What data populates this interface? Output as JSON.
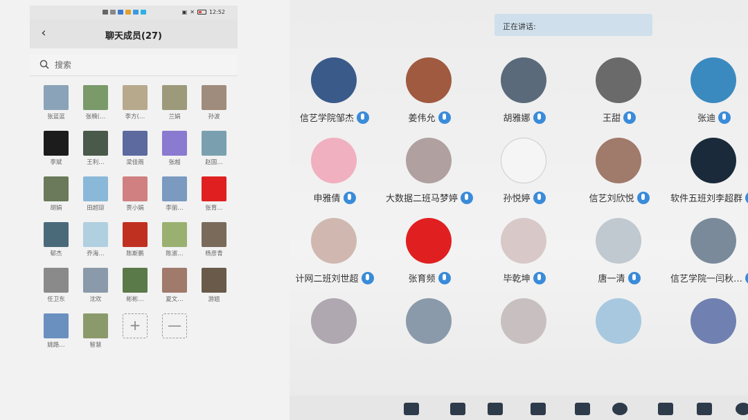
{
  "phone": {
    "status": {
      "time": "12:52"
    },
    "header": {
      "title": "聊天成员(27)"
    },
    "search": {
      "placeholder": "搜索"
    },
    "members": [
      {
        "name": "张蓝蓝",
        "color": "#8aa3b8"
      },
      {
        "name": "张楠(…",
        "color": "#7a9a6a"
      },
      {
        "name": "李方(…",
        "color": "#b7a98c"
      },
      {
        "name": "兰娟",
        "color": "#9c9a7a"
      },
      {
        "name": "孙波",
        "color": "#a08c7c"
      },
      {
        "name": "李斌",
        "color": "#1c1c1c"
      },
      {
        "name": "王利…",
        "color": "#4a5a4a"
      },
      {
        "name": "梁佳雨",
        "color": "#5c6aa0"
      },
      {
        "name": "张越",
        "color": "#8a7ad0"
      },
      {
        "name": "赵国…",
        "color": "#7aa0b0"
      },
      {
        "name": "胡娟",
        "color": "#6a7a5a"
      },
      {
        "name": "田超琼",
        "color": "#8ab8d8"
      },
      {
        "name": "贾小娟",
        "color": "#d08080"
      },
      {
        "name": "李丽…",
        "color": "#7a9ac0"
      },
      {
        "name": "张育…",
        "color": "#e02020"
      },
      {
        "name": "郁杰",
        "color": "#4a6a7a"
      },
      {
        "name": "乔海…",
        "color": "#b0d0e0"
      },
      {
        "name": "陈斯鹏",
        "color": "#c03020"
      },
      {
        "name": "陈淑…",
        "color": "#9ab070"
      },
      {
        "name": "杨彦青",
        "color": "#7a6a5a"
      },
      {
        "name": "任卫东",
        "color": "#8a8a8a"
      },
      {
        "name": "沈欢",
        "color": "#8a9aaa"
      },
      {
        "name": "彬彬…",
        "color": "#5a7a4a"
      },
      {
        "name": "夏文…",
        "color": "#a07a6a"
      },
      {
        "name": "游姐",
        "color": "#6a5a4a"
      },
      {
        "name": "姚路…",
        "color": "#6a90c0"
      },
      {
        "name": "智慧",
        "color": "#8a9a6a"
      }
    ],
    "add_label": "+",
    "remove_label": "—"
  },
  "meeting": {
    "speaking_label": "正在讲话:",
    "participants": [
      {
        "name": "信艺学院邹杰",
        "color": "#3a5a8a"
      },
      {
        "name": "姜伟允",
        "color": "#a05a40"
      },
      {
        "name": "胡雅娜",
        "color": "#5a6a7a"
      },
      {
        "name": "王甜",
        "color": "#6a6a6a"
      },
      {
        "name": "张迪",
        "color": "#3a8ac0"
      },
      {
        "name": "申雅倩",
        "color": "#f0b0c0"
      },
      {
        "name": "大数据二班马梦婷",
        "color": "#b0a0a0"
      },
      {
        "name": "孙悦婷",
        "color": "#f5f5f5"
      },
      {
        "name": "信艺刘欣悦",
        "color": "#a07a6a"
      },
      {
        "name": "软件五班刘李超群",
        "color": "#1a2a3a"
      },
      {
        "name": "计网二班刘世超",
        "color": "#d0b8b0"
      },
      {
        "name": "张育频",
        "color": "#e02020"
      },
      {
        "name": "毕乾坤",
        "color": "#d8c8c8"
      },
      {
        "name": "唐一清",
        "color": "#c0c8d0"
      },
      {
        "name": "信艺学院一闫秋…",
        "color": "#7a8a9a"
      },
      {
        "name": "",
        "color": "#b0a8b0"
      },
      {
        "name": "",
        "color": "#8a9aaa"
      },
      {
        "name": "",
        "color": "#c8c0c0"
      },
      {
        "name": "",
        "color": "#a8c8e0"
      },
      {
        "name": "",
        "color": "#7080b0"
      }
    ]
  }
}
